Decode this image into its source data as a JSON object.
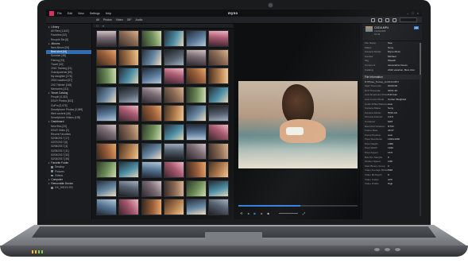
{
  "app": {
    "brand": "myno",
    "menu": [
      "File",
      "Edit",
      "View",
      "Settings",
      "Help"
    ],
    "window_controls": [
      "–",
      "□",
      "×"
    ]
  },
  "toolbar": {
    "filters": [
      "All",
      "Photos",
      "Video",
      "GIF",
      "Audio"
    ]
  },
  "sidebar": {
    "items": [
      {
        "label": "Library",
        "type": "group"
      },
      {
        "label": "All Files [1,842]",
        "type": "item"
      },
      {
        "label": "Favorites [42]",
        "type": "item"
      },
      {
        "label": "Recycle Bin [8]",
        "type": "item"
      },
      {
        "label": "Albums",
        "type": "group"
      },
      {
        "label": "New Album [24]",
        "type": "item"
      },
      {
        "label": "Best shot [44]",
        "type": "item",
        "selected": true
      },
      {
        "label": "Summer [48]",
        "type": "item"
      },
      {
        "label": "Fishing [23]",
        "type": "item"
      },
      {
        "label": "Travel [42]",
        "type": "item"
      },
      {
        "label": "2016 Training [21]",
        "type": "item"
      },
      {
        "label": "Grandparents [89]",
        "type": "item"
      },
      {
        "label": "My daughter [276]",
        "type": "item"
      },
      {
        "label": "2016 vacation [67]",
        "type": "item"
      },
      {
        "label": "2017 Winter [148]",
        "type": "item"
      },
      {
        "label": "Memories [111]",
        "type": "item"
      },
      {
        "label": "Smart Catalog",
        "type": "group"
      },
      {
        "label": "People [4,312]",
        "type": "item"
      },
      {
        "label": "DSLR Photos [812]",
        "type": "item"
      },
      {
        "label": "GoPro [2,075]",
        "type": "item"
      },
      {
        "label": "Smartphone Photos [4,089]",
        "type": "item"
      },
      {
        "label": "Web content [48]",
        "type": "item"
      },
      {
        "label": "Smartphone Videos [139]",
        "type": "item"
      },
      {
        "label": "Dashboard",
        "type": "group"
      },
      {
        "label": "New files [24]",
        "type": "item"
      },
      {
        "label": "DSLR Video [2]",
        "type": "item"
      },
      {
        "label": "Recent Favorites",
        "type": "item"
      },
      {
        "label": "02/08/2017 [17]",
        "type": "item"
      },
      {
        "label": "02/07/2017 [6]",
        "type": "item"
      },
      {
        "label": "02/06/2017 [4]",
        "type": "item"
      },
      {
        "label": "02/05/2017 [11]",
        "type": "item"
      },
      {
        "label": "02/04/2017 [32]",
        "type": "item"
      },
      {
        "label": "02/03/2017 [46]",
        "type": "item"
      },
      {
        "label": "Favorite Folder",
        "type": "group"
      },
      {
        "label": "Desktop",
        "type": "folder"
      },
      {
        "label": "Pictures",
        "type": "folder"
      },
      {
        "label": "Videos",
        "type": "folder"
      },
      {
        "label": "Computer",
        "type": "group"
      },
      {
        "label": "Removable Device",
        "type": "group"
      },
      {
        "label": "GX_DSC01.RS",
        "type": "folder"
      }
    ]
  },
  "viewer": {
    "photo_alt": "woman in the surf"
  },
  "info_panel": {
    "file_name": "C4314.MP4",
    "badge": "HD",
    "meta_lines": [
      "1920x1080",
      "01:42"
    ],
    "fields": [
      {
        "k": "File Name",
        "v": "Sea"
      },
      {
        "k": "Maker",
        "v": "Sony"
      },
      {
        "k": "Camera Model",
        "v": "Myno 2S14"
      },
      {
        "k": "Creator",
        "v": "Michael"
      },
      {
        "k": "Tag",
        "v": "#beach"
      },
      {
        "k": "Comment",
        "v": "Alexandria Ocean"
      },
      {
        "k": "Catalog",
        "v": "2016 vacation, Best shot"
      }
    ],
    "section_title": "File Information",
    "path": "D:\\Photo_Turkey_1C4314.MP4",
    "info": [
      {
        "k": "Start Timecode",
        "v": "00:00:00"
      },
      {
        "k": "End Timecode",
        "v": "00:01:42"
      },
      {
        "k": "Auto Exposure Mode",
        "v": "Full Auto"
      },
      {
        "k": "Auto Focus Mode",
        "v": "Center Weighted"
      },
      {
        "k": "Audio White Balance",
        "v": "Auto"
      },
      {
        "k": "Camera Maker",
        "v": "Sony"
      },
      {
        "k": "Camera Model",
        "v": "HDR-AS"
      },
      {
        "k": "Chroma Format",
        "v": "4:2:0"
      },
      {
        "k": "Container",
        "v": "MP4"
      },
      {
        "k": "Electrical Variation",
        "v": "NTSC"
      },
      {
        "k": "Frame Rate",
        "v": "29.97"
      },
      {
        "k": "Focus Position",
        "v": "Auto"
      },
      {
        "k": "Pixel Resolution",
        "v": "1920x1080"
      },
      {
        "k": "Pixel Height",
        "v": "1080"
      },
      {
        "k": "Pixel Width",
        "v": "1920"
      },
      {
        "k": "Pixel Aspect",
        "v": "16:9"
      },
      {
        "k": "Bits Per Sample",
        "v": "8"
      },
      {
        "k": "Shutter Speed",
        "v": "1/60"
      },
      {
        "k": "Start Binary Group",
        "v": "0"
      },
      {
        "k": "Video Average Bitrate",
        "v": "50M"
      },
      {
        "k": "Video Bit Depth",
        "v": "8"
      },
      {
        "k": "Video Codec",
        "v": "AVC"
      },
      {
        "k": "Video Profile",
        "v": "High"
      }
    ]
  },
  "colors": {
    "accent": "#2f7de1",
    "selection": "#2f6db3",
    "app_logo": "#d4335f"
  }
}
